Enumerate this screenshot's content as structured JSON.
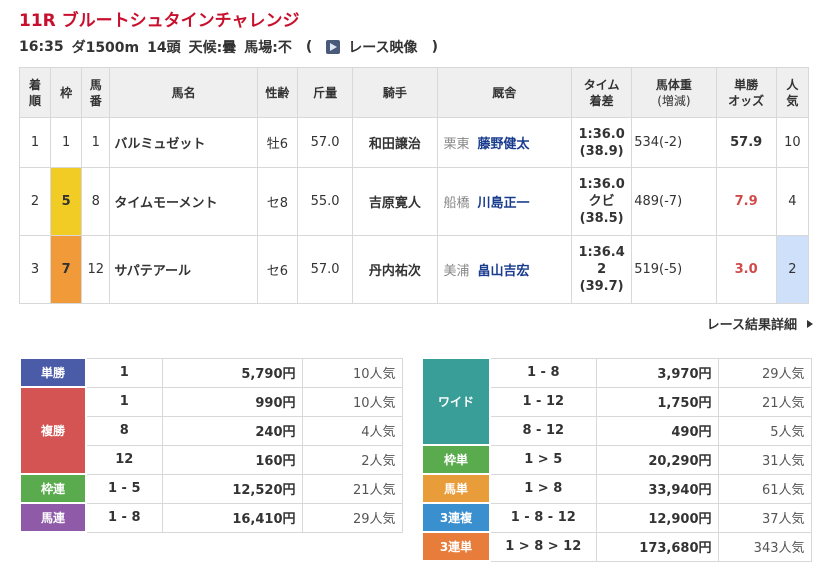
{
  "race": {
    "title": "11R ブルートシュタインチャレンジ",
    "time": "16:35",
    "course": "ダ1500m",
    "runners": "14頭",
    "weather": "天候:曇",
    "track": "馬場:不",
    "video_open": "(",
    "video_label": "レース映像",
    "video_close": ")"
  },
  "table": {
    "headers": {
      "rank": [
        "着",
        "順"
      ],
      "waku": "枠",
      "umaban": [
        "馬",
        "番"
      ],
      "horse": "馬名",
      "sexage": "性齢",
      "kinryo": "斤量",
      "jockey": "騎手",
      "trainer": "厩舎",
      "time": [
        "タイム",
        "着差"
      ],
      "weight": [
        "馬体重",
        "(増減)"
      ],
      "odds": [
        "単勝",
        "オッズ"
      ],
      "popularity": [
        "人",
        "気"
      ]
    },
    "rows": [
      {
        "rank": "1",
        "waku": "1",
        "umaban": "1",
        "horse": "バルミュゼット",
        "sexage": "牡6",
        "kinryo": "57.0",
        "jockey": "和田譲治",
        "region": "栗東",
        "trainer": "藤野健太",
        "time": "1:36.0",
        "margin": "",
        "last3f": "(38.9)",
        "weight": "534(-2)",
        "odds": "57.9",
        "popularity": "10"
      },
      {
        "rank": "2",
        "waku": "5",
        "umaban": "8",
        "horse": "タイムモーメント",
        "sexage": "セ8",
        "kinryo": "55.0",
        "jockey": "吉原寛人",
        "region": "船橋",
        "trainer": "川島正一",
        "time": "1:36.0",
        "margin": "クビ",
        "last3f": "(38.5)",
        "weight": "489(-7)",
        "odds": "7.9",
        "popularity": "4"
      },
      {
        "rank": "3",
        "waku": "7",
        "umaban": "12",
        "horse": "サパテアール",
        "sexage": "セ6",
        "kinryo": "57.0",
        "jockey": "丹内祐次",
        "region": "美浦",
        "trainer": "畠山吉宏",
        "time": "1:36.4",
        "margin": "2",
        "last3f": "(39.7)",
        "weight": "519(-5)",
        "odds": "3.0",
        "popularity": "2"
      }
    ]
  },
  "detail_link": "レース結果詳細",
  "payouts_left": {
    "tansho": {
      "label": "単勝",
      "rows": [
        {
          "combo": "1",
          "amount": "5,790円",
          "pop": "10人気"
        }
      ]
    },
    "fukusho": {
      "label": "複勝",
      "rows": [
        {
          "combo": "1",
          "amount": "990円",
          "pop": "10人気"
        },
        {
          "combo": "8",
          "amount": "240円",
          "pop": "4人気"
        },
        {
          "combo": "12",
          "amount": "160円",
          "pop": "2人気"
        }
      ]
    },
    "wakuren": {
      "label": "枠連",
      "rows": [
        {
          "combo": "1 - 5",
          "amount": "12,520円",
          "pop": "21人気"
        }
      ]
    },
    "umaren": {
      "label": "馬連",
      "rows": [
        {
          "combo": "1 - 8",
          "amount": "16,410円",
          "pop": "29人気"
        }
      ]
    }
  },
  "payouts_right": {
    "wide": {
      "label": "ワイド",
      "rows": [
        {
          "combo": "1 - 8",
          "amount": "3,970円",
          "pop": "29人気"
        },
        {
          "combo": "1 - 12",
          "amount": "1,750円",
          "pop": "21人気"
        },
        {
          "combo": "8 - 12",
          "amount": "490円",
          "pop": "5人気"
        }
      ]
    },
    "wakutan": {
      "label": "枠単",
      "rows": [
        {
          "combo": "1 > 5",
          "amount": "20,290円",
          "pop": "31人気"
        }
      ]
    },
    "umatan": {
      "label": "馬単",
      "rows": [
        {
          "combo": "1 > 8",
          "amount": "33,940円",
          "pop": "61人気"
        }
      ]
    },
    "sanrenpuku": {
      "label": "3連複",
      "rows": [
        {
          "combo": "1 - 8 - 12",
          "amount": "12,900円",
          "pop": "37人気"
        }
      ]
    },
    "sanrentan": {
      "label": "3連単",
      "rows": [
        {
          "combo": "1 > 8 > 12",
          "amount": "173,680円",
          "pop": "343人気"
        }
      ]
    }
  },
  "colors": {
    "title_red": "#c8102e",
    "link_blue": "#1a3c8f",
    "waku_5": "#f1cc24",
    "waku_7": "#f09a3a",
    "odds_red": "#d14a4a",
    "popularity_highlight": "#cfe0fb"
  },
  "icons": {
    "video": "video-play-icon",
    "detail": "chevron-right-icon"
  }
}
